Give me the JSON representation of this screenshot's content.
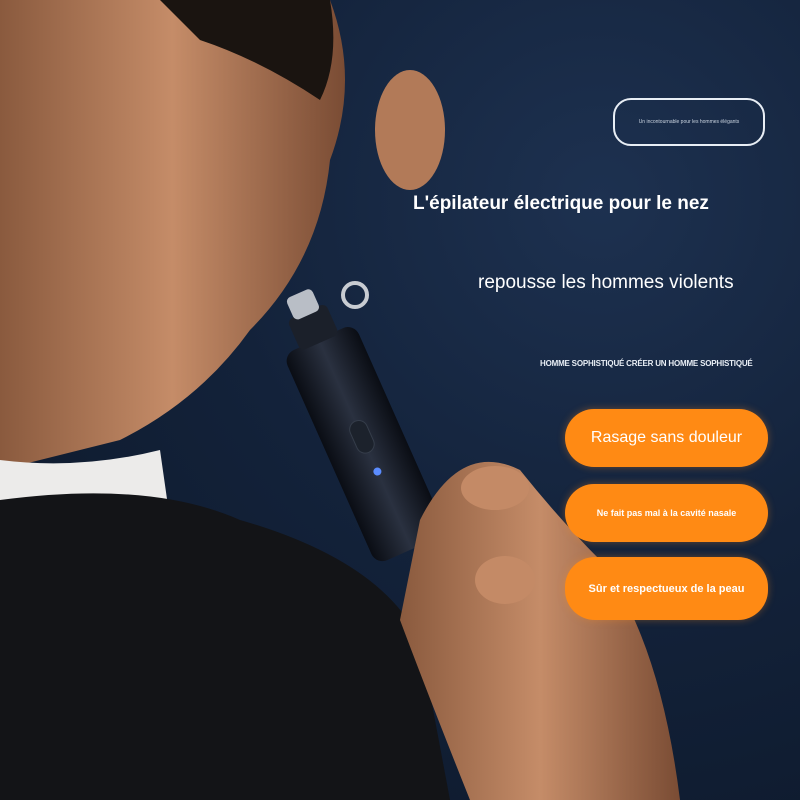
{
  "tagline": "Un incontournable pour les hommes élégants",
  "headline_1": "L'épilateur électrique pour le nez",
  "headline_2": "repousse les hommes violents",
  "subtitle": "HOMME SOPHISTIQUÉ CRÉER UN HOMME SOPHISTIQUÉ",
  "features": [
    "Rasage sans douleur",
    "Ne fait pas mal à la cavité nasale",
    "Sûr et respectueux de la peau"
  ],
  "colors": {
    "background": "#13223a",
    "accent": "#ff8a14",
    "text": "#ffffff"
  }
}
